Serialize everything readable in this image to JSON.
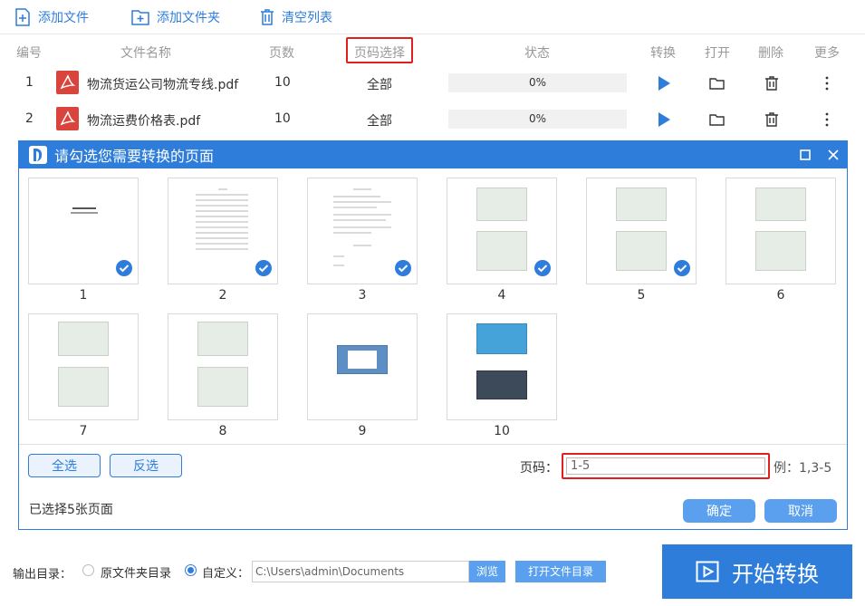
{
  "toolbar": {
    "add_file": "添加文件",
    "add_folder": "添加文件夹",
    "clear_list": "清空列表"
  },
  "table": {
    "headers": [
      "编号",
      "文件名称",
      "页数",
      "页码选择",
      "状态",
      "转换",
      "打开",
      "删除",
      "更多"
    ],
    "rows": [
      {
        "num": "1",
        "name": "物流货运公司物流专线.pdf",
        "pages": "10",
        "range": "全部",
        "status": "0%"
      },
      {
        "num": "2",
        "name": "物流运费价格表.pdf",
        "pages": "10",
        "range": "全部",
        "status": "0%"
      }
    ]
  },
  "dialog": {
    "title": "请勾选您需要转换的页面",
    "thumbs": [
      {
        "label": "1",
        "checked": true
      },
      {
        "label": "2",
        "checked": true
      },
      {
        "label": "3",
        "checked": true
      },
      {
        "label": "4",
        "checked": true
      },
      {
        "label": "5",
        "checked": true
      },
      {
        "label": "6",
        "checked": false
      },
      {
        "label": "7",
        "checked": false
      },
      {
        "label": "8",
        "checked": false
      },
      {
        "label": "9",
        "checked": false
      },
      {
        "label": "10",
        "checked": false
      }
    ],
    "select_all": "全选",
    "invert": "反选",
    "page_label": "页码：",
    "page_value": "1-5",
    "example": "例：1,3-5",
    "selected_info": "已选择5张页面",
    "ok": "确定",
    "cancel": "取消"
  },
  "output": {
    "label": "输出目录：",
    "opt_source": "原文件夹目录",
    "opt_custom": "自定义：",
    "path": "C:\\Users\\admin\\Documents",
    "browse": "浏览",
    "open_folder": "打开文件目录",
    "start": "开始转换"
  },
  "colors": {
    "accent": "#2f7ddb",
    "highlight": "#e02020",
    "pdf": "#d9453c"
  }
}
